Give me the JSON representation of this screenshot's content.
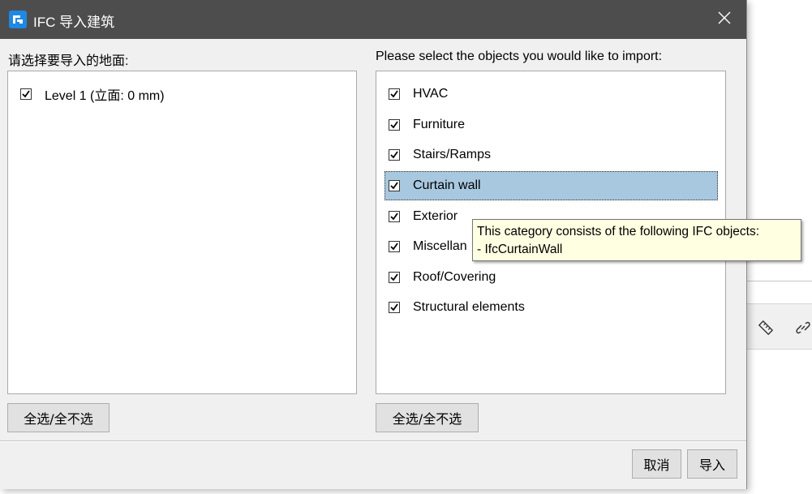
{
  "dialog": {
    "title": "IFC 导入建筑",
    "close_label": "✕"
  },
  "levels_panel": {
    "label": "请选择要导入的地面:",
    "items": [
      {
        "label": "Level 1 (立面: 0 mm)",
        "checked": true
      }
    ],
    "toggle_all_label": "全选/全不选"
  },
  "objects_panel": {
    "label": "Please select the objects you would like to import:",
    "items": [
      {
        "label": "HVAC",
        "checked": true
      },
      {
        "label": "Furniture",
        "checked": true
      },
      {
        "label": "Stairs/Ramps",
        "checked": true
      },
      {
        "label": "Curtain wall",
        "checked": true,
        "selected": true
      },
      {
        "label": "Exterior",
        "checked": true
      },
      {
        "label": "Miscellan",
        "checked": true
      },
      {
        "label": "Roof/Covering",
        "checked": true
      },
      {
        "label": "Structural elements",
        "checked": true
      }
    ],
    "toggle_all_label": "全选/全不选"
  },
  "tooltip": {
    "line1": "This category consists of the following IFC objects:",
    "line2": "- IfcCurtainWall"
  },
  "footer": {
    "cancel_label": "取消",
    "import_label": "导入"
  },
  "colors": {
    "titlebar": "#4d4d4d",
    "selection": "#a8c8e0",
    "tooltip_bg": "#ffffe1",
    "logo": "#1e88e5"
  }
}
